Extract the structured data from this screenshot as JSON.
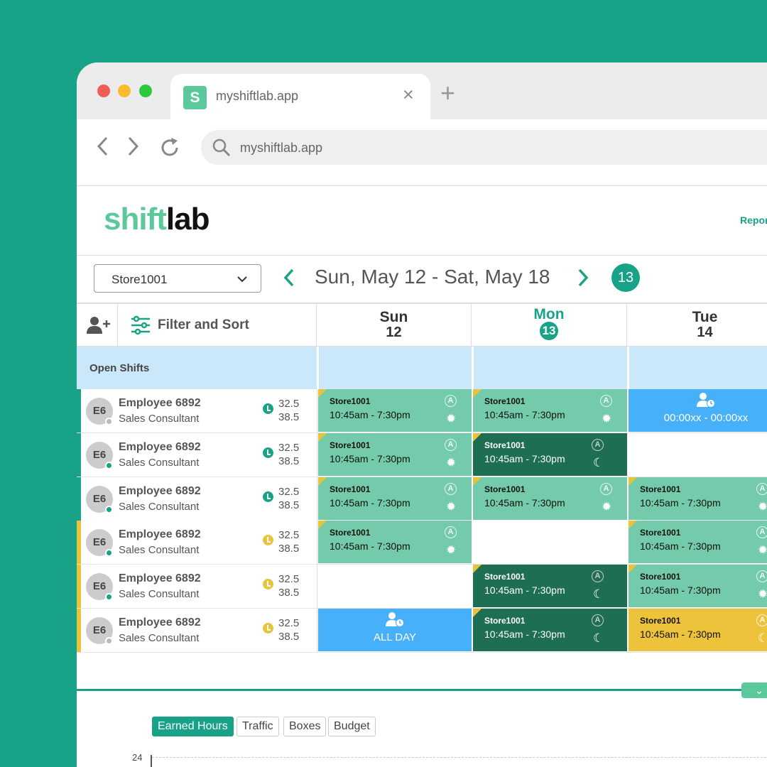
{
  "browser": {
    "tab_title": "myshiftlab.app",
    "tab_logo": "S",
    "url": "myshiftlab.app",
    "close_glyph": "×",
    "new_tab_glyph": "+",
    "dots": [
      "#f05f57",
      "#f8bd2e",
      "#2ac940"
    ]
  },
  "app": {
    "logo_part1": "shift",
    "logo_part2": "lab",
    "nav_partial": "Repor"
  },
  "controls": {
    "store": "Store1001",
    "date_range": "Sun, May 12 - Sat, May 18",
    "today_badge": "13"
  },
  "grid": {
    "filter_label": "Filter and Sort",
    "open_shifts_label": "Open Shifts",
    "days": [
      {
        "name": "Sun",
        "num": "12",
        "today": false
      },
      {
        "name": "Mon",
        "num": "13",
        "today": true
      },
      {
        "name": "Tue",
        "num": "14",
        "today": false
      }
    ],
    "rows": [
      {
        "avatar": "E6",
        "name": "Employee 6892",
        "role": "Sales Consultant",
        "h1": "32.5",
        "h2": "38.5",
        "bar": "#18a388",
        "clock": "#18a388",
        "status": "#bbb",
        "cells": [
          {
            "k": "light",
            "icon": "sun"
          },
          {
            "k": "light",
            "icon": "sun"
          },
          {
            "k": "blue",
            "time": "00:00xx - 00:00xx"
          }
        ]
      },
      {
        "avatar": "E6",
        "name": "Employee 6892",
        "role": "Sales Consultant",
        "h1": "32.5",
        "h2": "38.5",
        "bar": "#18a388",
        "clock": "#18a388",
        "status": "#18a388",
        "cells": [
          {
            "k": "light",
            "icon": "sun"
          },
          {
            "k": "dark",
            "icon": "moon"
          },
          {
            "k": "empty"
          }
        ]
      },
      {
        "avatar": "E6",
        "name": "Employee 6892",
        "role": "Sales Consultant",
        "h1": "32.5",
        "h2": "38.5",
        "bar": "#18a388",
        "clock": "#18a388",
        "status": "#18a388",
        "cells": [
          {
            "k": "light",
            "icon": "sun"
          },
          {
            "k": "light",
            "icon": "sun"
          },
          {
            "k": "light",
            "icon": "sun"
          }
        ]
      },
      {
        "avatar": "E6",
        "name": "Employee 6892",
        "role": "Sales Consultant",
        "h1": "32.5",
        "h2": "38.5",
        "bar": "#e8c33c",
        "clock": "#e8c33c",
        "status": "#18a388",
        "cells": [
          {
            "k": "light",
            "icon": "sun"
          },
          {
            "k": "empty"
          },
          {
            "k": "light",
            "icon": "sun"
          }
        ]
      },
      {
        "avatar": "E6",
        "name": "Employee 6892",
        "role": "Sales Consultant",
        "h1": "32.5",
        "h2": "38.5",
        "bar": "#e8c33c",
        "clock": "#e8c33c",
        "status": "#18a388",
        "cells": [
          {
            "k": "empty"
          },
          {
            "k": "dark",
            "icon": "moon"
          },
          {
            "k": "light",
            "icon": "sun"
          }
        ]
      },
      {
        "avatar": "E6",
        "name": "Employee 6892",
        "role": "Sales Consultant",
        "h1": "32.5",
        "h2": "38.5",
        "bar": "#e8c33c",
        "clock": "#e8c33c",
        "status": "#bbb",
        "cells": [
          {
            "k": "blue",
            "time": "ALL DAY"
          },
          {
            "k": "dark",
            "icon": "moon"
          },
          {
            "k": "yellow",
            "icon": "moon"
          }
        ]
      }
    ],
    "shift_store": "Store1001",
    "shift_time": "10:45am - 7:30pm",
    "avail_glyph": "A",
    "sun_glyph": "✹",
    "moon_glyph": "☾",
    "person_glyph": "👤"
  },
  "colors": {
    "light": "#73cbab",
    "dark": "#1e6e54",
    "yellow": "#eec33c",
    "blue": "#47b0fa"
  },
  "chart": {
    "tabs": [
      "Earned Hours",
      "Traffic",
      "Boxes",
      "Budget"
    ],
    "y_top": "24",
    "collapse_glyph": "⌄"
  }
}
